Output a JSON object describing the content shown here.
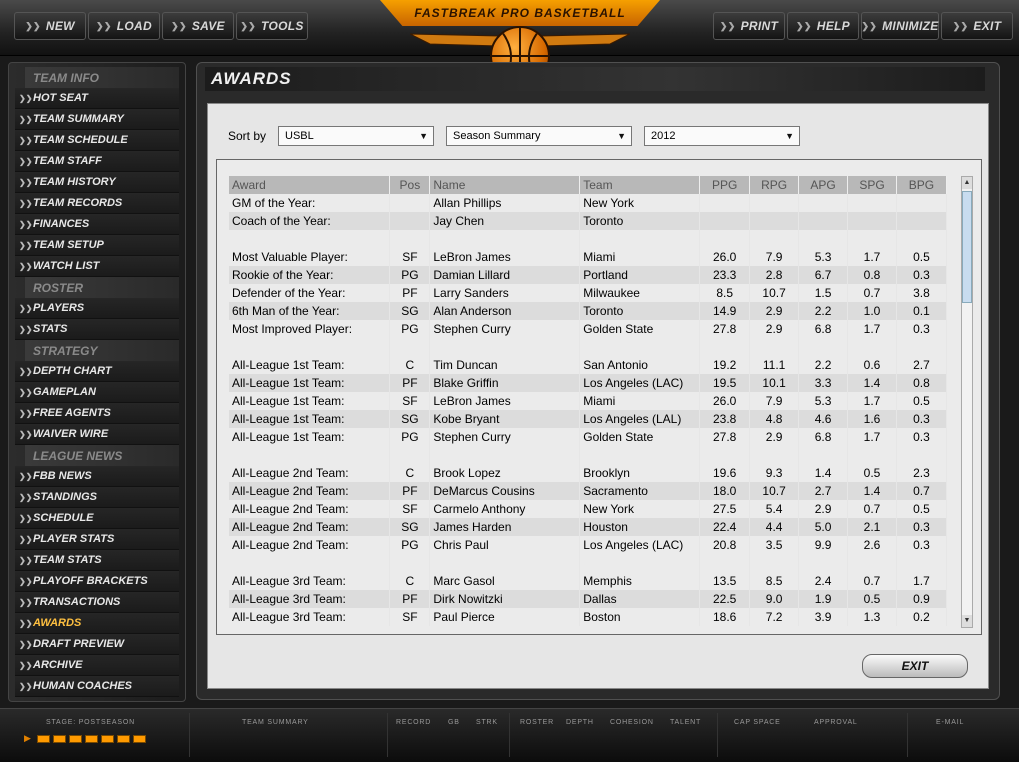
{
  "toolbar": {
    "left": [
      {
        "label": "NEW"
      },
      {
        "label": "LOAD"
      },
      {
        "label": "SAVE"
      },
      {
        "label": "TOOLS"
      }
    ],
    "right": [
      {
        "label": "PRINT"
      },
      {
        "label": "HELP"
      },
      {
        "label": "MINIMIZE"
      },
      {
        "label": "EXIT"
      }
    ],
    "logo_text": "FASTBREAK PRO BASKETBALL"
  },
  "sidebar": {
    "sections": [
      {
        "title": "TEAM INFO",
        "items": [
          "HOT SEAT",
          "TEAM SUMMARY",
          "TEAM SCHEDULE",
          "TEAM STAFF",
          "TEAM HISTORY",
          "TEAM RECORDS",
          "FINANCES",
          "TEAM SETUP",
          "WATCH LIST"
        ]
      },
      {
        "title": "ROSTER",
        "items": [
          "PLAYERS",
          "STATS"
        ]
      },
      {
        "title": "STRATEGY",
        "items": [
          "DEPTH CHART",
          "GAMEPLAN",
          "FREE AGENTS",
          "WAIVER WIRE"
        ]
      },
      {
        "title": "LEAGUE NEWS",
        "items": [
          "FBB NEWS",
          "STANDINGS",
          "SCHEDULE",
          "PLAYER STATS",
          "TEAM STATS",
          "PLAYOFF BRACKETS",
          "TRANSACTIONS",
          "AWARDS",
          "DRAFT PREVIEW",
          "ARCHIVE",
          "HUMAN COACHES"
        ]
      }
    ]
  },
  "page": {
    "title": "AWARDS",
    "sort_label": "Sort by",
    "filters": {
      "league": "USBL",
      "view": "Season Summary",
      "year": "2012"
    },
    "exit_label": "EXIT"
  },
  "table": {
    "columns": [
      "Award",
      "Pos",
      "Name",
      "Team",
      "PPG",
      "RPG",
      "APG",
      "SPG",
      "BPG"
    ],
    "rows": [
      [
        "GM of the Year:",
        "",
        "Allan Phillips",
        "New York",
        "",
        "",
        "",
        "",
        ""
      ],
      [
        "Coach of the Year:",
        "",
        "Jay Chen",
        "Toronto",
        "",
        "",
        "",
        "",
        ""
      ],
      null,
      [
        "Most Valuable Player:",
        "SF",
        "LeBron James",
        "Miami",
        "26.0",
        "7.9",
        "5.3",
        "1.7",
        "0.5"
      ],
      [
        "Rookie of the Year:",
        "PG",
        "Damian Lillard",
        "Portland",
        "23.3",
        "2.8",
        "6.7",
        "0.8",
        "0.3"
      ],
      [
        "Defender of the Year:",
        "PF",
        "Larry Sanders",
        "Milwaukee",
        "8.5",
        "10.7",
        "1.5",
        "0.7",
        "3.8"
      ],
      [
        "6th Man of the Year:",
        "SG",
        "Alan Anderson",
        "Toronto",
        "14.9",
        "2.9",
        "2.2",
        "1.0",
        "0.1"
      ],
      [
        "Most Improved Player:",
        "PG",
        "Stephen Curry",
        "Golden State",
        "27.8",
        "2.9",
        "6.8",
        "1.7",
        "0.3"
      ],
      null,
      [
        "All-League 1st Team:",
        "C",
        "Tim Duncan",
        "San Antonio",
        "19.2",
        "11.1",
        "2.2",
        "0.6",
        "2.7"
      ],
      [
        "All-League 1st Team:",
        "PF",
        "Blake Griffin",
        "Los Angeles (LAC)",
        "19.5",
        "10.1",
        "3.3",
        "1.4",
        "0.8"
      ],
      [
        "All-League 1st Team:",
        "SF",
        "LeBron James",
        "Miami",
        "26.0",
        "7.9",
        "5.3",
        "1.7",
        "0.5"
      ],
      [
        "All-League 1st Team:",
        "SG",
        "Kobe Bryant",
        "Los Angeles (LAL)",
        "23.8",
        "4.8",
        "4.6",
        "1.6",
        "0.3"
      ],
      [
        "All-League 1st Team:",
        "PG",
        "Stephen Curry",
        "Golden State",
        "27.8",
        "2.9",
        "6.8",
        "1.7",
        "0.3"
      ],
      null,
      [
        "All-League 2nd Team:",
        "C",
        "Brook Lopez",
        "Brooklyn",
        "19.6",
        "9.3",
        "1.4",
        "0.5",
        "2.3"
      ],
      [
        "All-League 2nd Team:",
        "PF",
        "DeMarcus Cousins",
        "Sacramento",
        "18.0",
        "10.7",
        "2.7",
        "1.4",
        "0.7"
      ],
      [
        "All-League 2nd Team:",
        "SF",
        "Carmelo Anthony",
        "New York",
        "27.5",
        "5.4",
        "2.9",
        "0.7",
        "0.5"
      ],
      [
        "All-League 2nd Team:",
        "SG",
        "James Harden",
        "Houston",
        "22.4",
        "4.4",
        "5.0",
        "2.1",
        "0.3"
      ],
      [
        "All-League 2nd Team:",
        "PG",
        "Chris Paul",
        "Los Angeles (LAC)",
        "20.8",
        "3.5",
        "9.9",
        "2.6",
        "0.3"
      ],
      null,
      [
        "All-League 3rd Team:",
        "C",
        "Marc Gasol",
        "Memphis",
        "13.5",
        "8.5",
        "2.4",
        "0.7",
        "1.7"
      ],
      [
        "All-League 3rd Team:",
        "PF",
        "Dirk Nowitzki",
        "Dallas",
        "22.5",
        "9.0",
        "1.9",
        "0.5",
        "0.9"
      ],
      [
        "All-League 3rd Team:",
        "SF",
        "Paul Pierce",
        "Boston",
        "18.6",
        "7.2",
        "3.9",
        "1.3",
        "0.2"
      ]
    ]
  },
  "status": {
    "stage": "STAGE: POSTSEASON",
    "stage_lights": 7,
    "segments": [
      {
        "labels": [
          "TEAM SUMMARY"
        ]
      },
      {
        "labels": [
          "RECORD",
          "GB",
          "STRK"
        ]
      },
      {
        "labels": [
          "ROSTER",
          "DEPTH",
          "COHESION",
          "TALENT"
        ]
      },
      {
        "labels": [
          "CAP SPACE",
          "APPROVAL"
        ]
      },
      {
        "labels": [
          "E-MAIL"
        ]
      }
    ]
  },
  "colors": {
    "accent": "#ff9a00",
    "panel": "#e6e6e6",
    "header_row": "#b8b8b8"
  }
}
